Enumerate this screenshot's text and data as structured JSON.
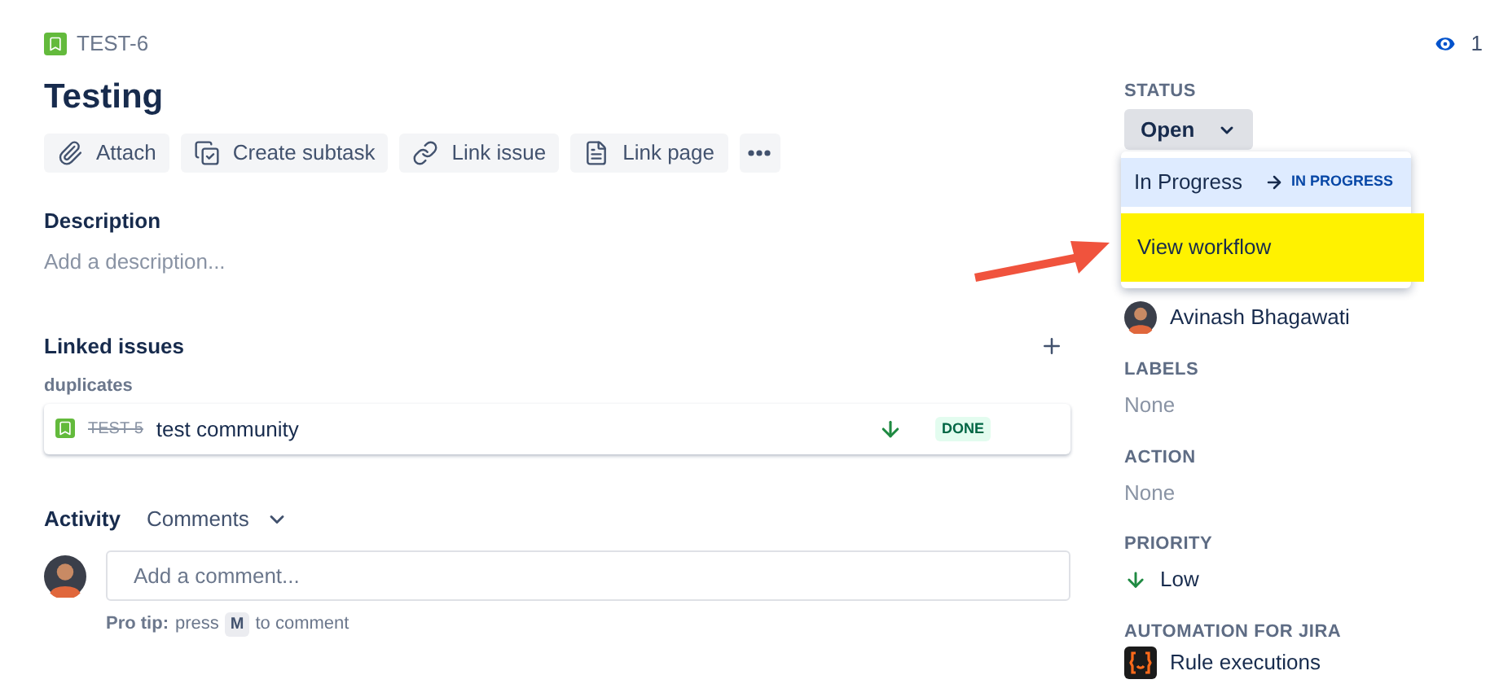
{
  "issue": {
    "key": "TEST-6",
    "title": "Testing"
  },
  "watchers": {
    "count": "1"
  },
  "actions": [
    {
      "label": "Attach"
    },
    {
      "label": "Create subtask"
    },
    {
      "label": "Link issue"
    },
    {
      "label": "Link page"
    }
  ],
  "description": {
    "title": "Description",
    "placeholder": "Add a description..."
  },
  "linked_issues": {
    "title": "Linked issues",
    "relation": "duplicates",
    "items": [
      {
        "key": "TEST-5",
        "resolved": true,
        "summary": "test community",
        "status": "DONE"
      }
    ]
  },
  "activity": {
    "title": "Activity",
    "filter": "Comments",
    "comment_placeholder": "Add a comment...",
    "tip_label": "Pro tip:",
    "tip_before": "press",
    "tip_key": "M",
    "tip_after": "to comment"
  },
  "status": {
    "label": "STATUS",
    "value": "Open",
    "menu": [
      {
        "kind": "transition",
        "label": "In Progress",
        "target": "IN PROGRESS",
        "selected": true,
        "highlighted": false
      },
      {
        "kind": "link",
        "label": "View workflow",
        "selected": false,
        "highlighted": true
      }
    ]
  },
  "fields": [
    {
      "kind": "user",
      "value": "Avinash Bhagawati"
    },
    {
      "kind": "empty",
      "label": "LABELS",
      "value": "None"
    },
    {
      "kind": "empty",
      "label": "ACTION",
      "value": "None"
    },
    {
      "kind": "priority",
      "label": "PRIORITY",
      "value": "Low"
    },
    {
      "kind": "app",
      "label": "AUTOMATION FOR JIRA",
      "value": "Rule executions"
    }
  ]
}
